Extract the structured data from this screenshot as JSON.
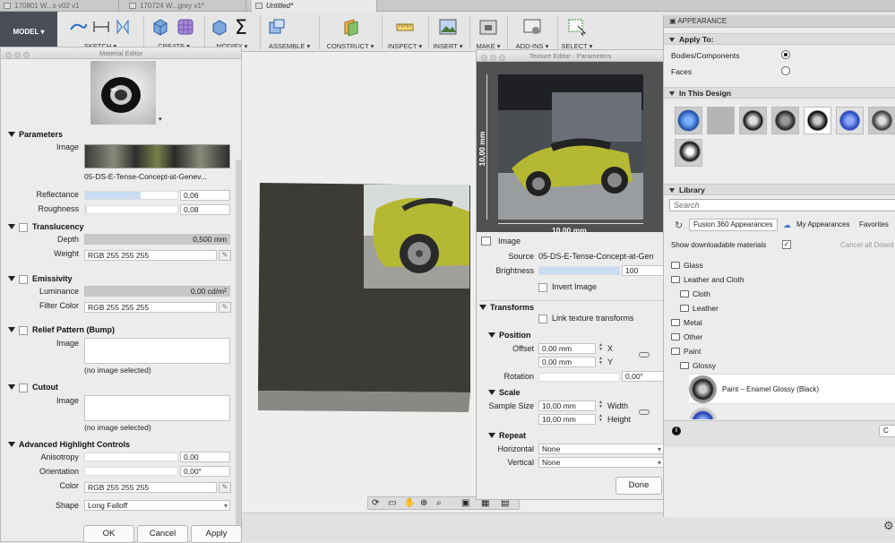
{
  "tabs": [
    "170801 W...s v02 v1",
    "170724 W...grey v1*",
    "Untitled*"
  ],
  "toolbar": {
    "model": "MODEL ▾",
    "groups": [
      "SKETCH ▾",
      "CREATE ▾",
      "MODIFY ▾",
      "ASSEMBLE ▾",
      "CONSTRUCT ▾",
      "INSPECT ▾",
      "INSERT ▾",
      "MAKE ▾",
      "ADD-INS ▾",
      "SELECT ▾"
    ]
  },
  "material_editor": {
    "title": "Material Editor",
    "parameters": {
      "heading": "Parameters",
      "image_label": "Image",
      "image_name": "05-DS-E-Tense-Concept-at-Genev...",
      "reflectance_label": "Reflectance",
      "reflectance_value": "0,06",
      "reflectance_level": 0.06,
      "roughness_label": "Roughness",
      "roughness_value": "0,08",
      "roughness_level": 0.08
    },
    "translucency": {
      "heading": "Translucency",
      "depth_label": "Depth",
      "depth_value": "0,500 mm",
      "weight_label": "Weight",
      "weight_value": "RGB 255 255 255"
    },
    "emissivity": {
      "heading": "Emissivity",
      "luminance_label": "Luminance",
      "luminance_value": "0,00 cd/m²",
      "filter_label": "Filter Color",
      "filter_value": "RGB 255 255 255"
    },
    "relief": {
      "heading": "Relief Pattern (Bump)",
      "image_label": "Image",
      "none": "(no image selected)"
    },
    "cutout": {
      "heading": "Cutout",
      "image_label": "Image",
      "none": "(no image selected)"
    },
    "advanced": {
      "heading": "Advanced Highlight Controls",
      "anisotropy_label": "Anisotropy",
      "anisotropy_value": "0,00",
      "orientation_label": "Orientation",
      "orientation_value": "0,00°",
      "color_label": "Color",
      "color_value": "RGB 255 255 255",
      "shape_label": "Shape",
      "shape_value": "Long Falloff"
    },
    "buttons": {
      "ok": "OK",
      "cancel": "Cancel",
      "apply": "Apply"
    }
  },
  "texture_editor": {
    "title": "Texture Editor - Parameters",
    "dim_width": "10,00 mm",
    "dim_height": "10,00 mm",
    "image_heading": "Image",
    "source_label": "Source",
    "source_value": "05-DS-E-Tense-Concept-at-Gen",
    "brightness_label": "Brightness",
    "brightness_value": "100",
    "invert_label": "Invert Image",
    "transforms_heading": "Transforms",
    "link_label": "Link texture transforms",
    "position_heading": "Position",
    "offset_label": "Offset",
    "offset_x": "0,00 mm",
    "x_label": "X",
    "offset_y": "0,00 mm",
    "y_label": "Y",
    "rotation_label": "Rotation",
    "rotation_value": "0,00°",
    "scale_heading": "Scale",
    "sample_label": "Sample Size",
    "sample_w": "10,00 mm",
    "width_label": "Width",
    "sample_h": "10,00 mm",
    "height_label": "Height",
    "repeat_heading": "Repeat",
    "horizontal_label": "Horizontal",
    "horizontal_value": "None",
    "vertical_label": "Vertical",
    "vertical_value": "None",
    "done": "Done"
  },
  "appearance": {
    "title": "APPEARANCE",
    "apply_to": "Apply To:",
    "bodies": "Bodies/Components",
    "faces": "Faces",
    "in_design": "In This Design",
    "library": "Library",
    "search_placeholder": "Search",
    "lib_tabs": [
      "Fusion 360 Appearances",
      "My Appearances",
      "Favorites"
    ],
    "show_downloadable": "Show downloadable materials",
    "cancel_all": "Cancel all Downl",
    "tree": [
      "Glass",
      "Leather and Cloth",
      "Cloth",
      "Leather",
      "Metal",
      "Other",
      "Paint",
      "Glossy"
    ],
    "selected_item": "Paint – Enamel Glossy (Black)",
    "info_btn": "C"
  },
  "colors": {
    "accent": "#c9dcf2",
    "toolbar_dark": "#4a4f57",
    "car": "#b5b833"
  }
}
